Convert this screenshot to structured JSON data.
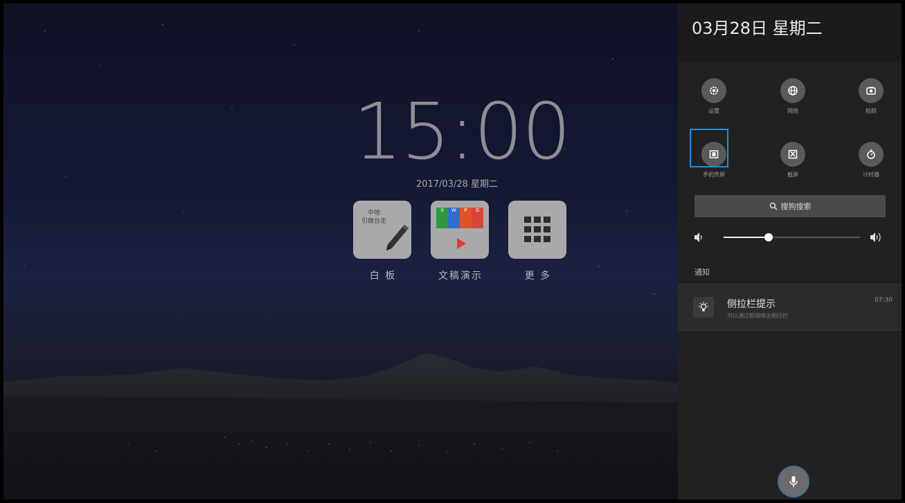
{
  "home": {
    "clock": "15:00",
    "date": "2017/03/28  星期二",
    "apps": [
      {
        "label": "白 板",
        "icon": "whiteboard-icon",
        "tile_text": "中地\n引做台走"
      },
      {
        "label": "文稿演示",
        "icon": "presentation-icon",
        "tile_letters": [
          "X",
          "W",
          "P",
          "G"
        ]
      },
      {
        "label": "更 多",
        "icon": "grid-icon"
      }
    ]
  },
  "panel": {
    "date": "03月28日  星期二",
    "toggles": [
      {
        "label": "设置",
        "icon": "settings-gear-icon"
      },
      {
        "label": "网络",
        "icon": "globe-icon"
      },
      {
        "label": "拍照",
        "icon": "camera-icon"
      },
      {
        "label": "手机传屏",
        "icon": "phone-cast-icon"
      },
      {
        "label": "截屏",
        "icon": "screenshot-scissors-icon"
      },
      {
        "label": "计时器",
        "icon": "timer-icon"
      }
    ],
    "search_label": "搜狗搜索",
    "volume": 0.33,
    "notifications_header": "通知",
    "notification": {
      "title": "侧拉栏提示",
      "subtitle": "可以通过侧滑唤出侧拉栏",
      "time": "07:30",
      "icon": "lightbulb-icon"
    },
    "mic_icon": "microphone-icon"
  },
  "colors": {
    "highlight": "#1e8fe0",
    "panel_bg": "#212121",
    "accent_red": "#e53935"
  }
}
